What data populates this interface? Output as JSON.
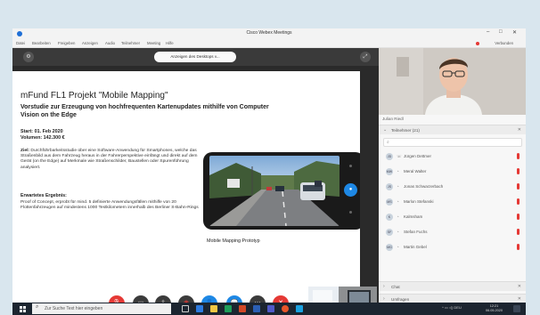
{
  "window": {
    "title": "Cisco Webex Meetings",
    "min_glyph": "–",
    "max_glyph": "□",
    "close_glyph": "✕"
  },
  "menubar": {
    "items": [
      "Datei",
      "Bearbeiten",
      "Freigeben",
      "Anzeigen",
      "Audio",
      "Teilnehmer",
      "Meeting",
      "Hilfe"
    ],
    "webex_label": "Verbunden"
  },
  "share": {
    "view_dropdown": "Anzeigen des Desktops v..."
  },
  "slide": {
    "title": "mFund FL1 Projekt \"Mobile Mapping\"",
    "subtitle": "Vorstudie zur Erzeugung von hochfrequenten Kartenupdates mithilfe von Computer Vision on the Edge",
    "start": "Start: 01. Feb 2020",
    "volume": "Volumen: 142.300 €",
    "goal_label": "Ziel:",
    "goal_text": "Durchführbarkeitsstudie über eine Software-Anwendung für Smartphones, welche das Straßenbild aus dem Fahrzeug heraus in der Fahrerperspektive einfängt und direkt auf dem Gerät (on the Edge) auf Merkmale wie Straßenschilder, Baustellen oder Spurenführung analysiert.",
    "result_heading": "Erwartetes Ergebnis:",
    "result_text": "Proof of Concept, erprobt für mind. 5 definierte Anwendungsfällen mithilfe von 20 Flottenfahrzeugen auf mindestens 1000 Testkilometern innerhalb des Berliner S-Bahn-Rings",
    "caption": "Mobile Mapping Prototyp"
  },
  "video": {
    "name": "Julian Riedl"
  },
  "participants": {
    "header": "Teilnehmer (21)",
    "list": [
      {
        "initials": "JD",
        "name": "Jürgen Dettmer"
      },
      {
        "initials": "MW",
        "name": "Meral Walter"
      },
      {
        "initials": "JS",
        "name": "Jonas Schwarzerbach"
      },
      {
        "initials": "MS",
        "name": "Marlon Stefanski"
      },
      {
        "initials": "K",
        "name": "Kalmsham"
      },
      {
        "initials": "SF",
        "name": "Stefan Fuchs"
      },
      {
        "initials": "MG",
        "name": "Martin Gebel"
      }
    ]
  },
  "panels": {
    "chat": "Chat",
    "polls": "Umfragen"
  },
  "taskbar": {
    "search_placeholder": "Zur Suche Text hier eingeben",
    "tray": "^  ▭  ◁)  DEU",
    "time": "12:21",
    "date": "06.05.2020"
  },
  "colors": {
    "webex_red": "#e53935",
    "webex_blue": "#1e88e5",
    "taskbar": "#1c2530"
  }
}
